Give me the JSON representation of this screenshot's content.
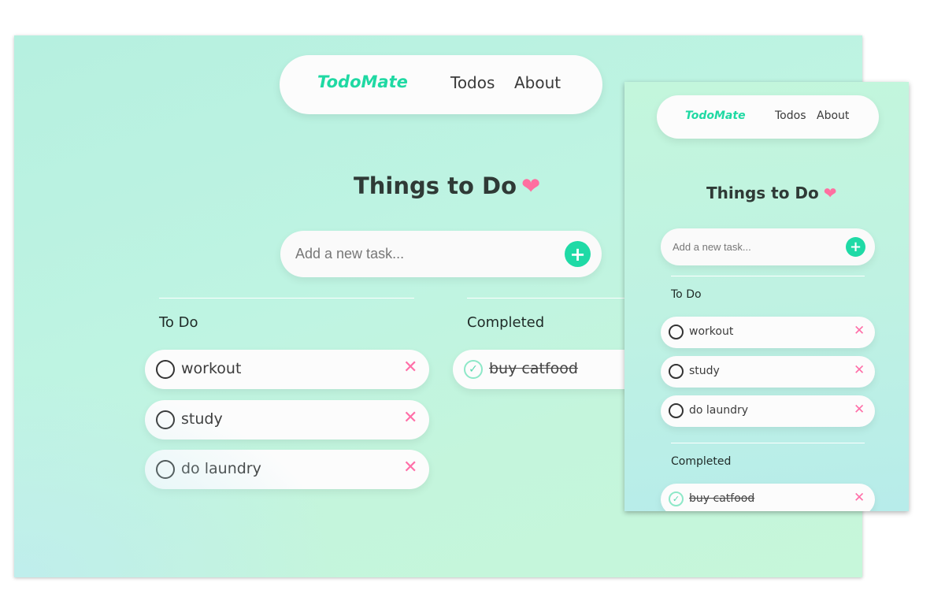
{
  "app": {
    "brand": "TodoMate",
    "nav": {
      "todos": "Todos",
      "about": "About"
    },
    "title": "Things to Do",
    "heart": "❤",
    "add_placeholder": "Add a new task...",
    "add_icon": "+",
    "sections": {
      "todo": "To Do",
      "completed": "Completed"
    },
    "todo_items": [
      "workout",
      "study",
      "do laundry"
    ],
    "completed_items": [
      "buy catfood"
    ],
    "delete_icon": "✕",
    "check_icon": "✓"
  },
  "colors": {
    "accent": "#1fdaa6",
    "delete": "#ff6fa8",
    "heart": "#ff6fa0",
    "check": "#5ad9b0"
  }
}
